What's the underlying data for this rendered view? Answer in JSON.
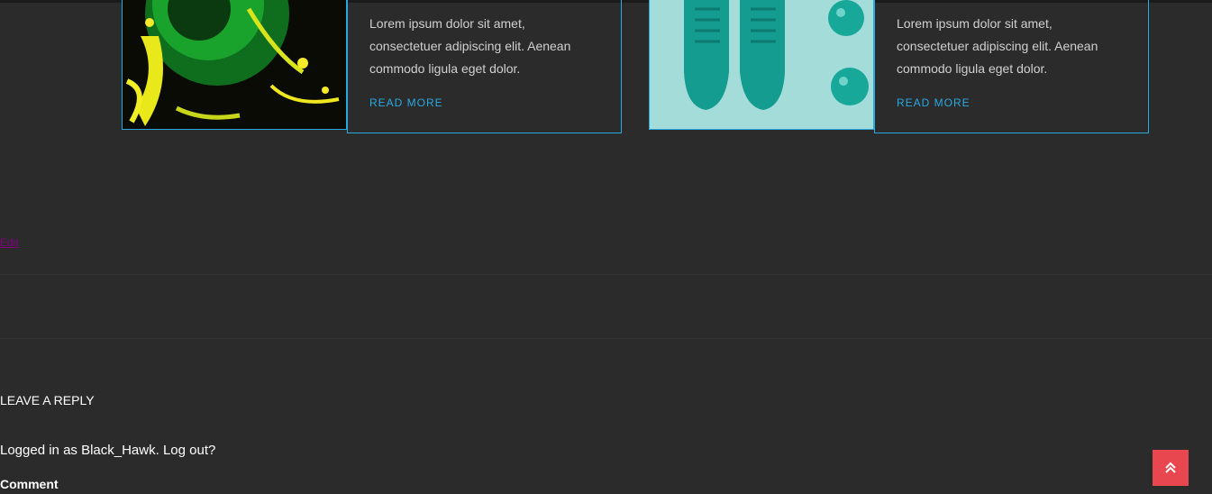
{
  "cards": [
    {
      "image_name": "green-helmet-image",
      "text": "Lorem ipsum dolor sit amet, consectetuer adipiscing elit. Aenean commodo ligula eget dolor.",
      "read_more": "READ MORE"
    },
    {
      "image_name": "teal-sneakers-image",
      "text": "Lorem ipsum dolor sit amet, consectetuer adipiscing elit. Aenean commodo ligula eget dolor.",
      "read_more": "READ MORE"
    }
  ],
  "edit_link": "Edit",
  "reply": {
    "title": "LEAVE A REPLY",
    "logged_in_prefix": "Logged in as ",
    "username": "Black_Hawk",
    "separator": ". ",
    "logout": "Log out?",
    "comment_label": "Comment"
  },
  "back_to_top": {
    "icon": "double-chevron-up-icon",
    "color": "#e9474f"
  },
  "colors": {
    "background": "#2b2b2b",
    "accent": "#29a9e1",
    "visited_link": "#800080"
  }
}
